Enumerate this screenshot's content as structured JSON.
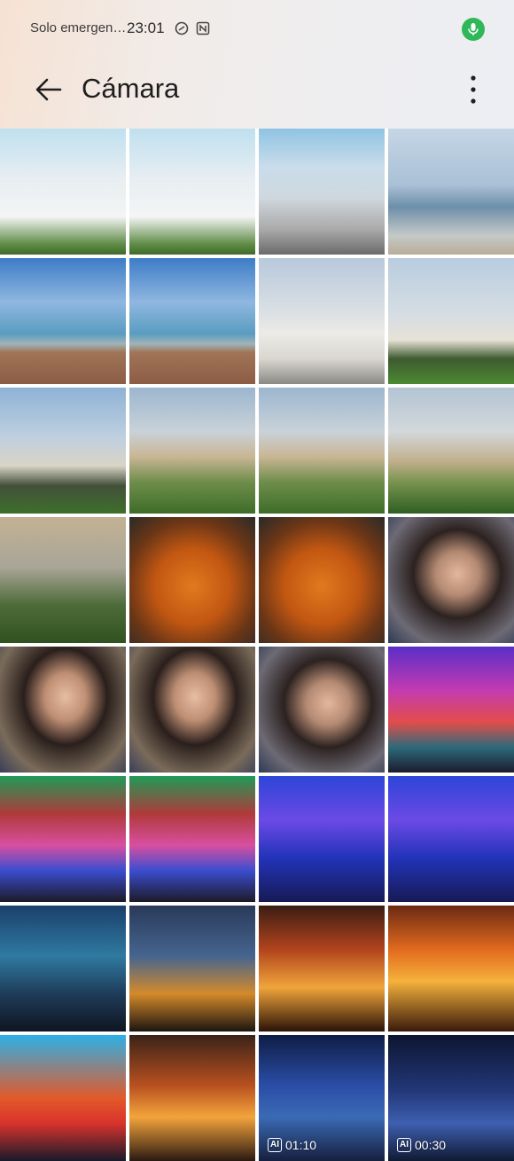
{
  "status_bar": {
    "carrier": "Solo emergen…",
    "time": "23:01",
    "icons": [
      "do-not-disturb-icon",
      "nfc-icon",
      "microphone-icon"
    ],
    "mic_color": "#2fb75a"
  },
  "app_bar": {
    "title": "Cámara",
    "back_icon": "arrow-left-icon",
    "menu_icon": "more-vert-icon"
  },
  "thumbnails": [
    {
      "type": "photo",
      "subject": "upside-down-house"
    },
    {
      "type": "photo",
      "subject": "upside-down-house"
    },
    {
      "type": "photo",
      "subject": "upside-down-house"
    },
    {
      "type": "photo",
      "subject": "west-pier"
    },
    {
      "type": "photo",
      "subject": "beach-pier"
    },
    {
      "type": "photo",
      "subject": "beach-pier"
    },
    {
      "type": "photo",
      "subject": "pavilion-dome"
    },
    {
      "type": "photo",
      "subject": "pavilion"
    },
    {
      "type": "photo",
      "subject": "pavilion"
    },
    {
      "type": "photo",
      "subject": "building-garden"
    },
    {
      "type": "photo",
      "subject": "building-garden"
    },
    {
      "type": "photo",
      "subject": "building-garden"
    },
    {
      "type": "photo",
      "subject": "statue"
    },
    {
      "type": "photo",
      "subject": "noodles"
    },
    {
      "type": "photo",
      "subject": "noodles"
    },
    {
      "type": "photo",
      "subject": "portrait"
    },
    {
      "type": "photo",
      "subject": "portrait"
    },
    {
      "type": "photo",
      "subject": "portrait"
    },
    {
      "type": "photo",
      "subject": "portrait"
    },
    {
      "type": "photo",
      "subject": "concert-stage"
    },
    {
      "type": "photo",
      "subject": "concert-stage"
    },
    {
      "type": "photo",
      "subject": "concert-stage"
    },
    {
      "type": "photo",
      "subject": "concert-stage"
    },
    {
      "type": "photo",
      "subject": "concert-stage"
    },
    {
      "type": "photo",
      "subject": "concert-stage"
    },
    {
      "type": "photo",
      "subject": "concert-stage"
    },
    {
      "type": "photo",
      "subject": "concert-stage"
    },
    {
      "type": "photo",
      "subject": "concert-stage"
    },
    {
      "type": "photo",
      "subject": "concert-stage"
    },
    {
      "type": "photo",
      "subject": "concert-stage"
    },
    {
      "type": "video",
      "subject": "concert-stage",
      "duration": "01:10",
      "badge": "AI"
    },
    {
      "type": "video",
      "subject": "concert-stage",
      "duration": "00:30",
      "badge": "AI"
    }
  ]
}
